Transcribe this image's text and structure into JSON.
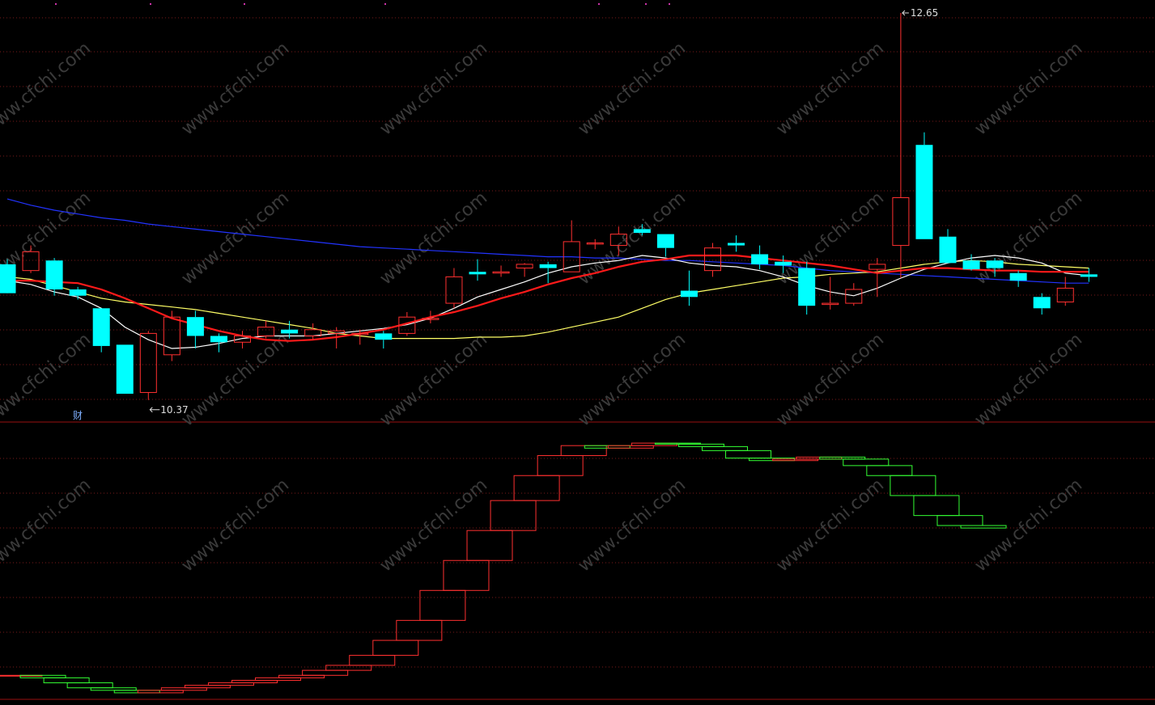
{
  "chart_data": [
    {
      "type": "candlestick",
      "annotations": {
        "high_label": "12.65",
        "low_label": "10.37",
        "marker_char": "财"
      },
      "watermark": "www.cfchi.com",
      "colors": {
        "up": "#ff3030",
        "down": "#00ffff",
        "ma_short": "#ffffff",
        "ma_mid": "#ff1a1a",
        "ma_long": "#ffff66",
        "ma_very_long": "#2233ff",
        "grid": "#7a1a1a",
        "divider": "#9a1010"
      },
      "candles": [
        [
          10.65,
          10.42,
          10.62,
          10.69
        ],
        [
          10.6,
          10.75,
          10.8,
          10.58
        ],
        [
          10.68,
          10.45,
          10.7,
          10.4
        ],
        [
          10.45,
          10.4,
          10.47,
          10.37
        ],
        [
          10.3,
          10.0,
          10.3,
          9.95
        ],
        [
          10.01,
          9.62,
          10.01,
          9.62
        ],
        [
          9.63,
          10.1,
          10.12,
          9.57
        ],
        [
          9.93,
          10.23,
          10.28,
          9.88
        ],
        [
          10.23,
          10.08,
          10.28,
          9.98
        ],
        [
          10.08,
          10.03,
          10.1,
          9.95
        ],
        [
          10.03,
          10.08,
          10.12,
          9.98
        ],
        [
          10.08,
          10.15,
          10.2,
          10.06
        ],
        [
          10.13,
          10.1,
          10.2,
          10.06
        ],
        [
          10.08,
          10.13,
          10.18,
          10.05
        ],
        [
          10.1,
          10.12,
          10.15,
          9.98
        ],
        [
          10.1,
          10.1,
          10.13,
          10.01
        ],
        [
          10.1,
          10.05,
          10.12,
          9.98
        ],
        [
          10.1,
          10.23,
          10.27,
          10.08
        ],
        [
          10.22,
          10.22,
          10.28,
          10.18
        ],
        [
          10.34,
          10.55,
          10.62,
          10.3
        ],
        [
          10.59,
          10.57,
          10.69,
          10.52
        ],
        [
          10.58,
          10.59,
          10.64,
          10.55
        ],
        [
          10.62,
          10.65,
          10.66,
          10.55
        ],
        [
          10.65,
          10.62,
          10.67,
          10.5
        ],
        [
          10.59,
          10.83,
          11.0,
          10.59
        ],
        [
          10.82,
          10.82,
          10.85,
          10.77
        ],
        [
          10.8,
          10.89,
          10.95,
          10.72
        ],
        [
          10.93,
          10.9,
          10.97,
          10.88
        ],
        [
          10.89,
          10.78,
          10.89,
          10.71
        ],
        [
          10.44,
          10.39,
          10.6,
          10.32
        ],
        [
          10.6,
          10.78,
          10.82,
          10.55
        ],
        [
          10.82,
          10.8,
          10.88,
          10.75
        ],
        [
          10.73,
          10.65,
          10.8,
          10.61
        ],
        [
          10.67,
          10.64,
          10.72,
          10.58
        ],
        [
          10.62,
          10.32,
          10.67,
          10.25
        ],
        [
          10.33,
          10.34,
          10.55,
          10.29
        ],
        [
          10.34,
          10.45,
          10.5,
          10.32
        ],
        [
          10.61,
          10.65,
          10.7,
          10.39
        ],
        [
          10.8,
          11.18,
          12.65,
          10.54
        ],
        [
          11.6,
          10.85,
          11.7,
          10.85
        ],
        [
          10.87,
          10.66,
          10.93,
          10.66
        ],
        [
          10.68,
          10.61,
          10.73,
          10.6
        ],
        [
          10.68,
          10.62,
          10.7,
          10.55
        ],
        [
          10.58,
          10.52,
          10.6,
          10.47
        ],
        [
          10.39,
          10.3,
          10.42,
          10.25
        ],
        [
          10.35,
          10.46,
          10.55,
          10.32
        ],
        [
          10.57,
          10.55,
          10.62,
          10.51
        ]
      ],
      "ma_short": [
        10.52,
        10.49,
        10.43,
        10.39,
        10.3,
        10.15,
        10.05,
        9.98,
        9.99,
        10.02,
        10.06,
        10.08,
        10.08,
        10.08,
        10.1,
        10.12,
        10.14,
        10.17,
        10.22,
        10.3,
        10.39,
        10.45,
        10.51,
        10.58,
        10.63,
        10.66,
        10.68,
        10.72,
        10.7,
        10.66,
        10.64,
        10.63,
        10.6,
        10.55,
        10.48,
        10.43,
        10.4,
        10.46,
        10.54,
        10.61,
        10.66,
        10.7,
        10.72,
        10.7,
        10.66,
        10.58,
        10.56
      ],
      "ma_mid": [
        10.52,
        10.52,
        10.51,
        10.5,
        10.45,
        10.38,
        10.3,
        10.22,
        10.17,
        10.12,
        10.08,
        10.05,
        10.04,
        10.05,
        10.07,
        10.1,
        10.13,
        10.18,
        10.23,
        10.27,
        10.32,
        10.38,
        10.43,
        10.49,
        10.54,
        10.58,
        10.63,
        10.67,
        10.69,
        10.72,
        10.72,
        10.72,
        10.7,
        10.68,
        10.66,
        10.64,
        10.61,
        10.58,
        10.6,
        10.62,
        10.62,
        10.61,
        10.6,
        10.6,
        10.59,
        10.59,
        10.59
      ],
      "ma_long": [
        10.55,
        10.53,
        10.48,
        10.43,
        10.38,
        10.35,
        10.33,
        10.31,
        10.29,
        10.26,
        10.23,
        10.2,
        10.17,
        10.14,
        10.1,
        10.08,
        10.06,
        10.06,
        10.06,
        10.06,
        10.07,
        10.07,
        10.08,
        10.11,
        10.15,
        10.19,
        10.23,
        10.3,
        10.37,
        10.42,
        10.45,
        10.48,
        10.51,
        10.54,
        10.55,
        10.57,
        10.58,
        10.59,
        10.62,
        10.65,
        10.67,
        10.68,
        10.67,
        10.65,
        10.64,
        10.63,
        10.62
      ],
      "ma_very_long": [
        11.17,
        11.12,
        11.08,
        11.05,
        11.02,
        11.0,
        10.97,
        10.95,
        10.93,
        10.91,
        10.89,
        10.87,
        10.85,
        10.83,
        10.81,
        10.79,
        10.78,
        10.77,
        10.76,
        10.75,
        10.74,
        10.73,
        10.72,
        10.71,
        10.71,
        10.7,
        10.7,
        10.69,
        10.68,
        10.68,
        10.67,
        10.66,
        10.65,
        10.64,
        10.62,
        10.6,
        10.59,
        10.58,
        10.57,
        10.56,
        10.55,
        10.54,
        10.53,
        10.52,
        10.51,
        10.5,
        10.5
      ],
      "grid": true
    },
    {
      "type": "box-indicator",
      "colors": {
        "up": "#ff3030",
        "down": "#33ff33"
      },
      "boxes": [
        [
          1.0,
          1.0
        ],
        [
          1.0,
          0.5
        ],
        [
          0.5,
          -0.5
        ],
        [
          -0.5,
          -1.5
        ],
        [
          -1.5,
          -2.0
        ],
        [
          -2.0,
          -2.5
        ],
        [
          -2.5,
          -2.0
        ],
        [
          -2.0,
          -1.5
        ],
        [
          -1.5,
          -1.0
        ],
        [
          -1.0,
          -0.5
        ],
        [
          -0.5,
          0.0
        ],
        [
          0.0,
          0.5
        ],
        [
          0.5,
          1.0
        ],
        [
          1.0,
          2.0
        ],
        [
          2.0,
          3.0
        ],
        [
          3.0,
          5.0
        ],
        [
          5.0,
          8.0
        ],
        [
          8.0,
          12.0
        ],
        [
          12.0,
          18.0
        ],
        [
          18.0,
          24.0
        ],
        [
          24.0,
          30.0
        ],
        [
          30.0,
          36.0
        ],
        [
          36.0,
          41.0
        ],
        [
          41.0,
          45.0
        ],
        [
          45.0,
          47.0
        ],
        [
          47.0,
          46.5
        ],
        [
          46.5,
          47.0
        ],
        [
          47.0,
          47.5
        ],
        [
          47.5,
          47.3
        ],
        [
          47.3,
          46.8
        ],
        [
          46.8,
          46.0
        ],
        [
          46.0,
          44.5
        ],
        [
          44.5,
          44.0
        ],
        [
          44.0,
          44.3
        ],
        [
          44.3,
          44.7
        ],
        [
          44.7,
          44.3
        ],
        [
          44.3,
          43.0
        ],
        [
          43.0,
          41.0
        ],
        [
          41.0,
          37.0
        ],
        [
          37.0,
          33.0
        ],
        [
          33.0,
          31.0
        ],
        [
          31.0,
          30.5
        ]
      ]
    }
  ]
}
